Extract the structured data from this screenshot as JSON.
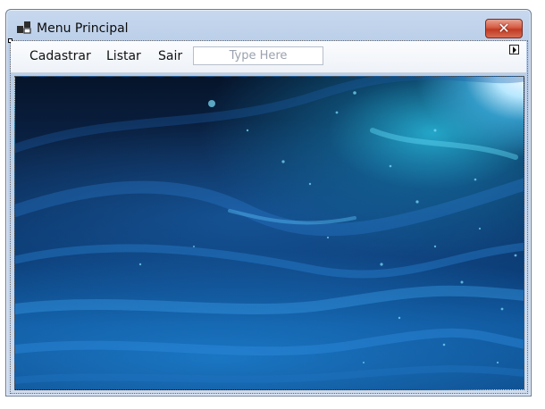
{
  "window": {
    "title": "Menu Principal",
    "close_glyph": "✕",
    "app_icon": "form-designer-icon",
    "colors": {
      "frame": "#c4d5ec",
      "close_button": "#c13a22",
      "menubar": "#f4f7fb"
    }
  },
  "menu": {
    "items": [
      "Cadastrar",
      "Listar",
      "Sair"
    ],
    "placeholder": "Type Here"
  },
  "picture": {
    "icon": "ocean-wave-picture",
    "colors": {
      "deep": "#06142a",
      "mid": "#0c4b8e",
      "glow": "#46bef0"
    }
  }
}
